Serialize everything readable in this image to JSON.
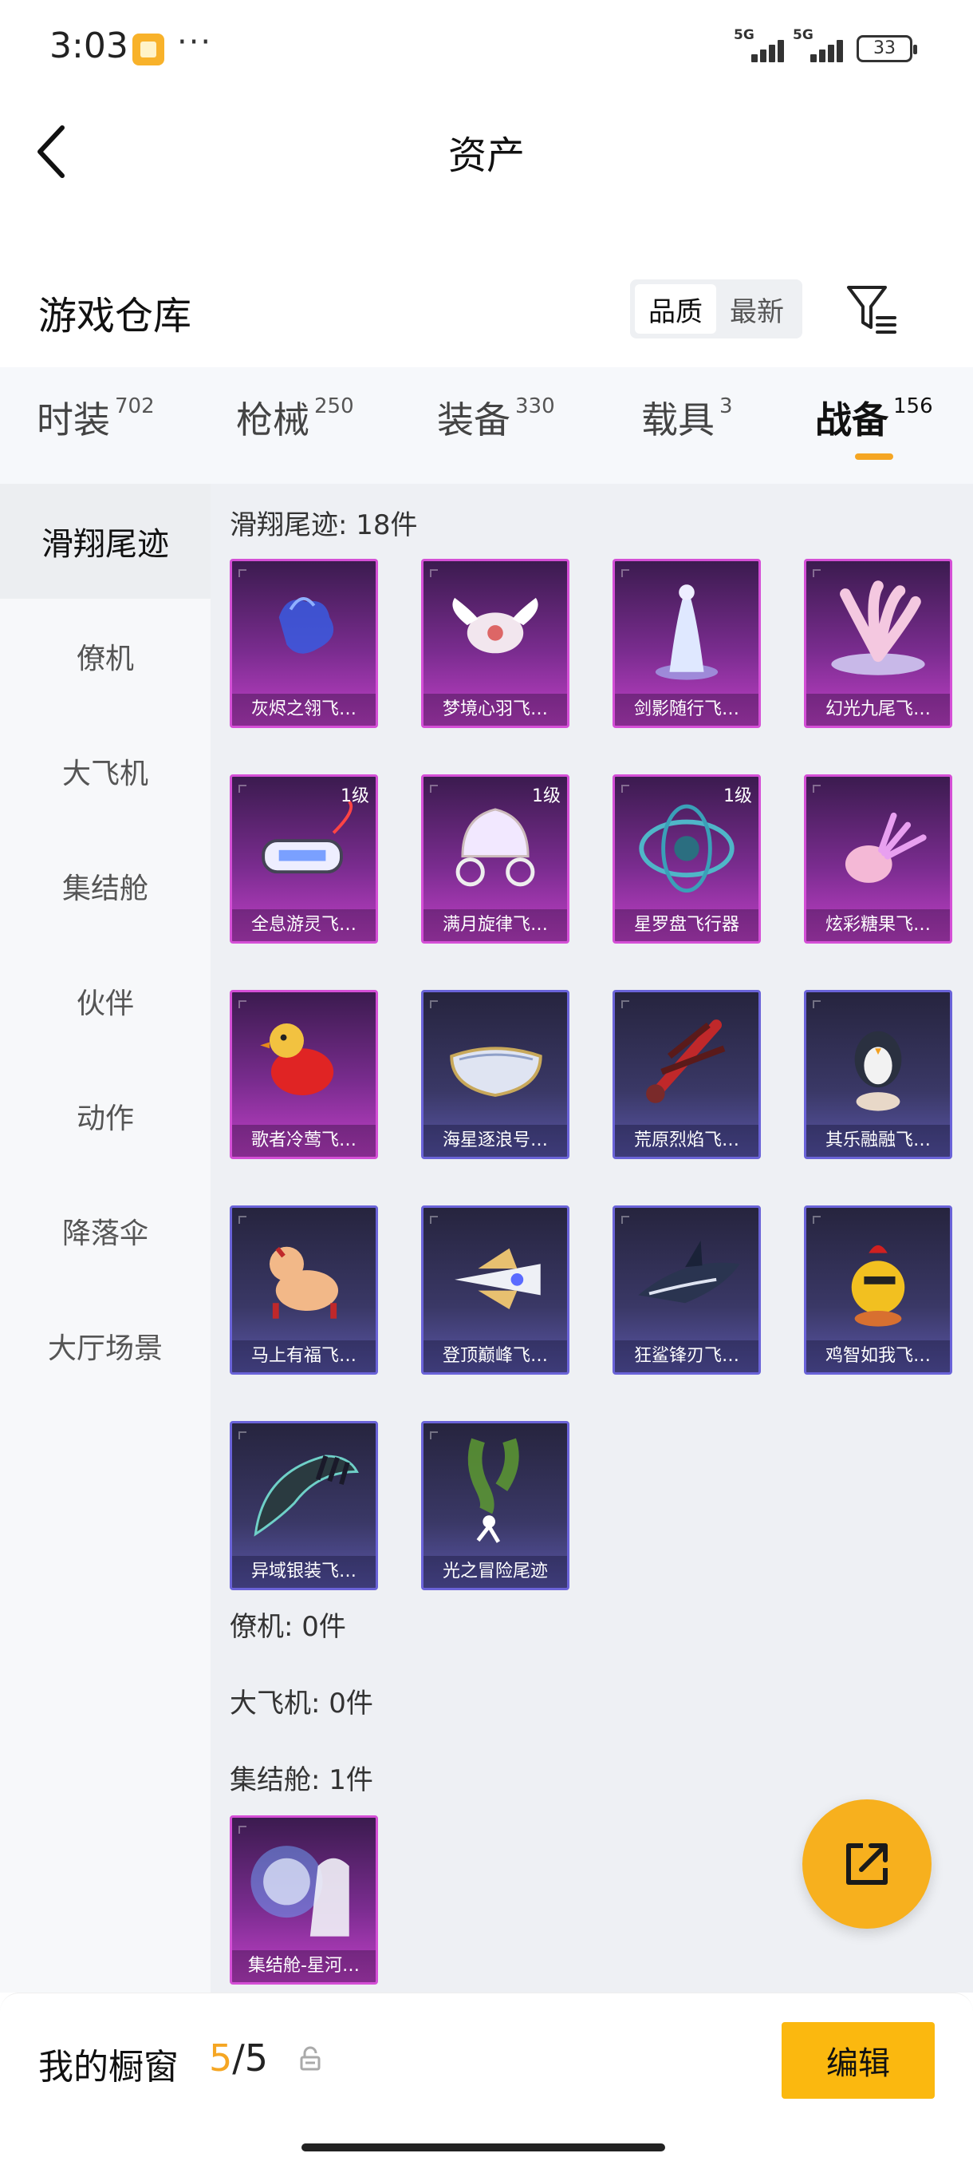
{
  "status_bar": {
    "time": "3:03",
    "dots": "···",
    "net1": "5G",
    "net2": "5G",
    "battery": "33"
  },
  "header": {
    "title": "资产"
  },
  "warehouse": {
    "title": "游戏仓库",
    "sort_options": [
      "品质",
      "最新"
    ],
    "active_sort": "品质"
  },
  "tabs": [
    {
      "label": "时装",
      "count": "702"
    },
    {
      "label": "枪械",
      "count": "250"
    },
    {
      "label": "装备",
      "count": "330"
    },
    {
      "label": "载具",
      "count": "3"
    },
    {
      "label": "战备",
      "count": "156"
    }
  ],
  "active_tab": "战备",
  "sidebar": {
    "items": [
      "滑翔尾迹",
      "僚机",
      "大飞机",
      "集结舱",
      "伙伴",
      "动作",
      "降落伞",
      "大厅场景"
    ],
    "active": "滑翔尾迹"
  },
  "groups": {
    "glide": {
      "label": "滑翔尾迹: 18件",
      "items": [
        {
          "name": "灰烬之翎飞…",
          "level": "",
          "rarity": "purple",
          "icon": "glove-icon"
        },
        {
          "name": "梦境心羽飞…",
          "level": "",
          "rarity": "purple",
          "icon": "winged-heart-icon"
        },
        {
          "name": "剑影随行飞…",
          "level": "",
          "rarity": "purple",
          "icon": "spirit-figure-icon"
        },
        {
          "name": "幻光九尾飞…",
          "level": "",
          "rarity": "purple",
          "icon": "nine-tail-icon"
        },
        {
          "name": "全息游灵飞…",
          "level": "1级",
          "rarity": "purple",
          "icon": "hover-device-icon"
        },
        {
          "name": "满月旋律飞…",
          "level": "1级",
          "rarity": "purple",
          "icon": "carriage-icon"
        },
        {
          "name": "星罗盘飞行器",
          "level": "1级",
          "rarity": "purple",
          "icon": "astrolabe-icon"
        },
        {
          "name": "炫彩糖果飞…",
          "level": "",
          "rarity": "purple",
          "icon": "candy-icon"
        },
        {
          "name": "歌者冷莺飞…",
          "level": "",
          "rarity": "purple",
          "icon": "bird-icon"
        },
        {
          "name": "海星逐浪号…",
          "level": "",
          "rarity": "blue",
          "icon": "boat-icon"
        },
        {
          "name": "荒原烈焰飞…",
          "level": "",
          "rarity": "blue",
          "icon": "flame-glider-icon"
        },
        {
          "name": "其乐融融飞…",
          "level": "",
          "rarity": "blue",
          "icon": "penguin-icon"
        },
        {
          "name": "马上有福飞…",
          "level": "",
          "rarity": "blue",
          "icon": "horse-icon"
        },
        {
          "name": "登顶巅峰飞…",
          "level": "",
          "rarity": "blue",
          "icon": "jet-icon"
        },
        {
          "name": "狂鲨锋刃飞…",
          "level": "",
          "rarity": "blue",
          "icon": "shark-icon"
        },
        {
          "name": "鸡智如我飞…",
          "level": "",
          "rarity": "blue",
          "icon": "chicken-icon"
        },
        {
          "name": "异域银装飞…",
          "level": "",
          "rarity": "blue",
          "icon": "blade-wing-icon"
        },
        {
          "name": "光之冒险尾迹",
          "level": "",
          "rarity": "blue",
          "icon": "smoke-trail-icon"
        }
      ]
    },
    "wingman": {
      "label": "僚机: 0件"
    },
    "plane": {
      "label": "大飞机: 0件"
    },
    "capsule": {
      "label": "集结舱: 1件",
      "items": [
        {
          "name": "集结舱-星河…",
          "level": "",
          "rarity": "purple",
          "icon": "portal-icon"
        }
      ]
    }
  },
  "bottom_bar": {
    "window_label": "我的橱窗",
    "current": "5",
    "separator": "/",
    "max": "5",
    "edit_label": "编辑"
  },
  "colors": {
    "accent": "#f5a623",
    "edit_button": "#fbb80f",
    "purple_rarity": "#c040c7",
    "blue_rarity": "#5a56a8"
  }
}
